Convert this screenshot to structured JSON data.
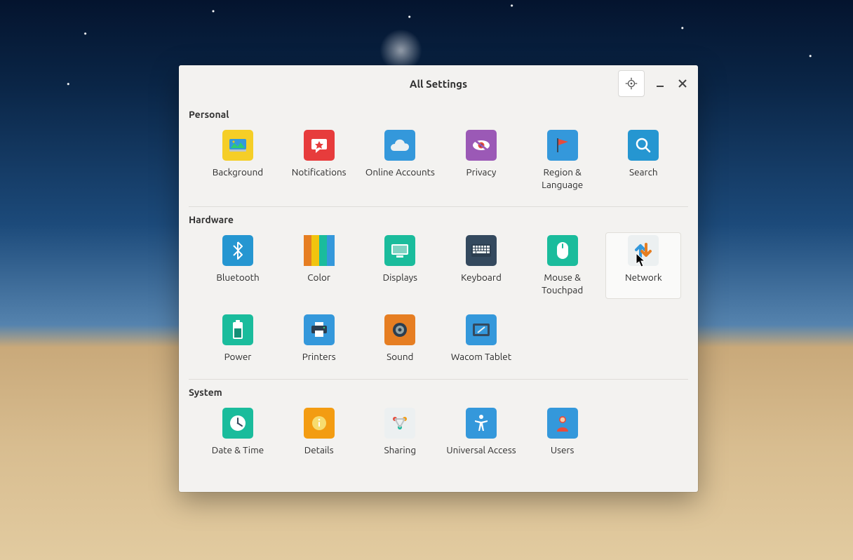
{
  "titlebar": {
    "title": "All Settings"
  },
  "sections": [
    {
      "title": "Personal",
      "items": [
        {
          "id": "background",
          "label": "Background"
        },
        {
          "id": "notifications",
          "label": "Notifications"
        },
        {
          "id": "online-accounts",
          "label": "Online Accounts"
        },
        {
          "id": "privacy",
          "label": "Privacy"
        },
        {
          "id": "region-language",
          "label": "Region & Language"
        },
        {
          "id": "search",
          "label": "Search"
        }
      ]
    },
    {
      "title": "Hardware",
      "items": [
        {
          "id": "bluetooth",
          "label": "Bluetooth"
        },
        {
          "id": "color",
          "label": "Color"
        },
        {
          "id": "displays",
          "label": "Displays"
        },
        {
          "id": "keyboard",
          "label": "Keyboard"
        },
        {
          "id": "mouse-touchpad",
          "label": "Mouse & Touchpad"
        },
        {
          "id": "network",
          "label": "Network",
          "highlight": true
        },
        {
          "id": "power",
          "label": "Power"
        },
        {
          "id": "printers",
          "label": "Printers"
        },
        {
          "id": "sound",
          "label": "Sound"
        },
        {
          "id": "wacom-tablet",
          "label": "Wacom Tablet"
        }
      ]
    },
    {
      "title": "System",
      "items": [
        {
          "id": "date-time",
          "label": "Date & Time"
        },
        {
          "id": "details",
          "label": "Details"
        },
        {
          "id": "sharing",
          "label": "Sharing"
        },
        {
          "id": "universal-access",
          "label": "Universal Access"
        },
        {
          "id": "users",
          "label": "Users"
        }
      ]
    }
  ]
}
